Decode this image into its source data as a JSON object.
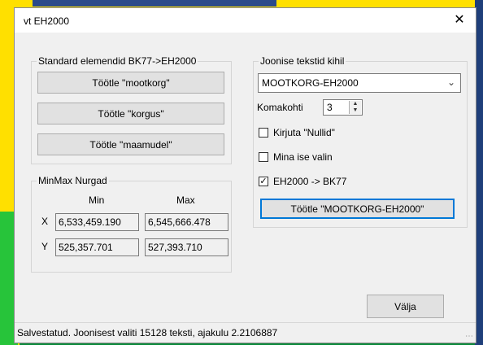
{
  "window": {
    "title": "vt EH2000",
    "close_glyph": "✕"
  },
  "standard_group": {
    "legend": "Standard elemendid BK77->EH2000",
    "buttons": [
      "Töötle \"mootkorg\"",
      "Töötle \"korgus\"",
      "Töötle \"maamudel\""
    ]
  },
  "minmax_group": {
    "legend": "MinMax Nurgad",
    "col_min": "Min",
    "col_max": "Max",
    "row_x": "X",
    "row_y": "Y",
    "x_min": "6,533,459.190",
    "x_max": "6,545,666.478",
    "y_min": "525,357.701",
    "y_max": "527,393.710"
  },
  "layer_group": {
    "legend": "Joonise tekstid kihil",
    "layer_selected": "MOOTKORG-EH2000",
    "comma_label": "Komakohti",
    "comma_value": "3",
    "checkboxes": [
      {
        "label": "Kirjuta \"Nullid\"",
        "checked": false
      },
      {
        "label": "Mina ise valin",
        "checked": false
      },
      {
        "label": "EH2000 -> BK77",
        "checked": true
      }
    ],
    "process_button": "Töötle \"MOOTKORG-EH2000\""
  },
  "exit_button": "Välja",
  "status": "Salvestatud. Joonisest valiti 15128 teksti, ajakulu 2.2106887",
  "colors": {
    "accent": "#0078d7",
    "dialog_bg": "#f0f0f0"
  }
}
